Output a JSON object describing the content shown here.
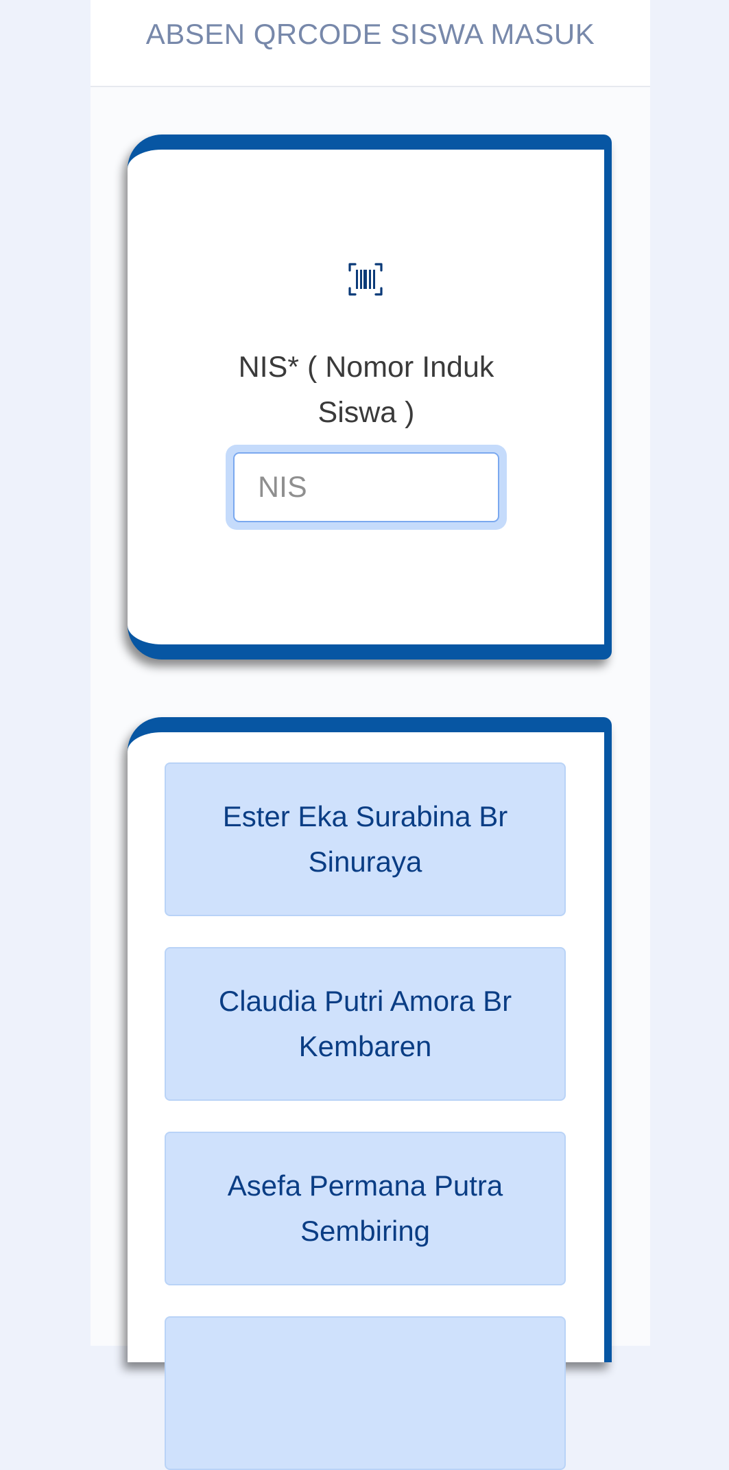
{
  "header": {
    "title": "ABSEN QRCODE SISWA MASUK"
  },
  "scan_card": {
    "icon": "barcode-scan-icon",
    "nis_label": "NIS* ( Nomor Induk Siswa )",
    "nis_placeholder": "NIS",
    "nis_value": ""
  },
  "students": [
    {
      "name": "Ester Eka Surabina Br Sinuraya"
    },
    {
      "name": "Claudia Putri Amora Br Kembaren"
    },
    {
      "name": "Asefa Permana Putra Sembiring"
    },
    {
      "name": ""
    }
  ],
  "colors": {
    "accent": "#0756a3",
    "item_bg": "#cfe1fc",
    "item_text": "#0a3d84",
    "header_text": "#7788aa"
  }
}
